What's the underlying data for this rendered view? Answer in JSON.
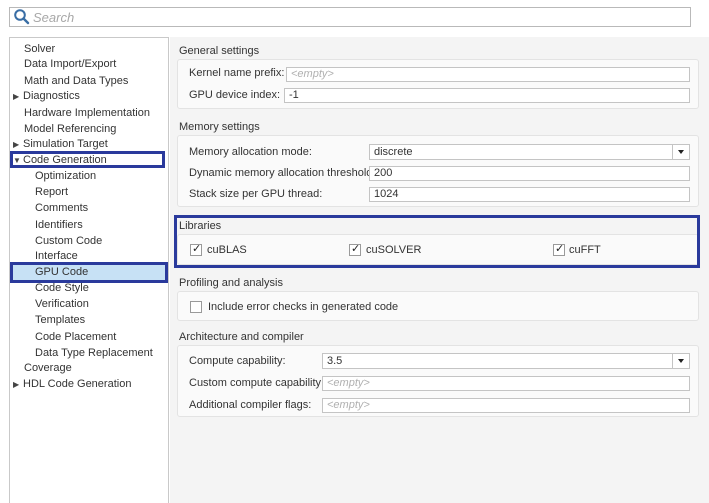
{
  "search": {
    "placeholder": "Search",
    "icon": "search-icon"
  },
  "sidebar": {
    "items": [
      {
        "label": "Solver",
        "level": 0,
        "expander": ""
      },
      {
        "label": "Data Import/Export",
        "level": 0,
        "expander": ""
      },
      {
        "label": "Math and Data Types",
        "level": 0,
        "expander": ""
      },
      {
        "label": "Diagnostics",
        "level": 0,
        "expander": "collapsed"
      },
      {
        "label": "Hardware Implementation",
        "level": 0,
        "expander": ""
      },
      {
        "label": "Model Referencing",
        "level": 0,
        "expander": ""
      },
      {
        "label": "Simulation Target",
        "level": 0,
        "expander": "collapsed"
      },
      {
        "label": "Code Generation",
        "level": 0,
        "expander": "expanded"
      },
      {
        "label": "Optimization",
        "level": 1,
        "expander": ""
      },
      {
        "label": "Report",
        "level": 1,
        "expander": ""
      },
      {
        "label": "Comments",
        "level": 1,
        "expander": ""
      },
      {
        "label": "Identifiers",
        "level": 1,
        "expander": ""
      },
      {
        "label": "Custom Code",
        "level": 1,
        "expander": ""
      },
      {
        "label": "Interface",
        "level": 1,
        "expander": ""
      },
      {
        "label": "GPU Code",
        "level": 1,
        "expander": ""
      },
      {
        "label": "Code Style",
        "level": 1,
        "expander": ""
      },
      {
        "label": "Verification",
        "level": 1,
        "expander": ""
      },
      {
        "label": "Templates",
        "level": 1,
        "expander": ""
      },
      {
        "label": "Code Placement",
        "level": 1,
        "expander": ""
      },
      {
        "label": "Data Type Replacement",
        "level": 1,
        "expander": ""
      },
      {
        "label": "Coverage",
        "level": 0,
        "expander": ""
      },
      {
        "label": "HDL Code Generation",
        "level": 0,
        "expander": "collapsed"
      }
    ],
    "selected": "GPU Code"
  },
  "general": {
    "title": "General settings",
    "kernel_label": "Kernel name prefix:",
    "kernel_placeholder": "<empty>",
    "gpu_index_label": "GPU device index:",
    "gpu_index_value": "-1"
  },
  "memory": {
    "title": "Memory settings",
    "alloc_mode_label": "Memory allocation mode:",
    "alloc_mode_value": "discrete",
    "threshold_label": "Dynamic memory allocation threshold:",
    "threshold_value": "200",
    "stack_label": "Stack size per GPU thread:",
    "stack_value": "1024"
  },
  "libraries": {
    "title": "Libraries",
    "cublas": {
      "label": "cuBLAS",
      "checked": true
    },
    "cusolver": {
      "label": "cuSOLVER",
      "checked": true
    },
    "cufft": {
      "label": "cuFFT",
      "checked": true
    }
  },
  "profiling": {
    "title": "Profiling and analysis",
    "error_checks_label": "Include error checks in generated code",
    "error_checks_checked": false
  },
  "arch": {
    "title": "Architecture and compiler",
    "compute_label": "Compute capability:",
    "compute_value": "3.5",
    "custom_label": "Custom compute capability:",
    "custom_placeholder": "<empty>",
    "flags_label": "Additional compiler flags:",
    "flags_placeholder": "<empty>"
  },
  "colors": {
    "highlight_box": "#2a3a9c",
    "selection": "#c7e1f5",
    "search_icon": "#3a6ea5"
  }
}
